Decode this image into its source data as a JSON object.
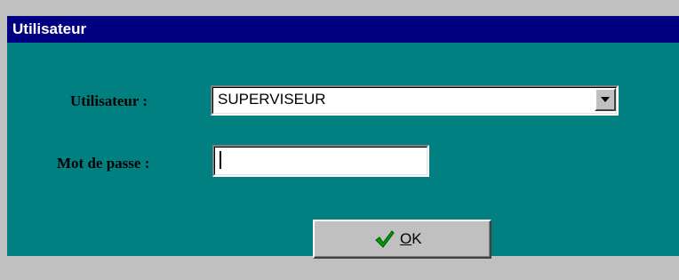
{
  "window": {
    "title": "Utilisateur"
  },
  "form": {
    "user_label": "Utilisateur :",
    "user_value": "SUPERVISEUR",
    "password_label": "Mot de passe :",
    "password_value": ""
  },
  "buttons": {
    "ok_mnemonic": "O",
    "ok_rest": "K"
  },
  "icons": {
    "ok_icon": "check-icon",
    "dropdown_icon": "chevron-down-icon"
  },
  "colors": {
    "titlebar": "#000080",
    "dialog_bg": "#008080",
    "button_face": "#c0c0c0",
    "check": "#00a000"
  }
}
